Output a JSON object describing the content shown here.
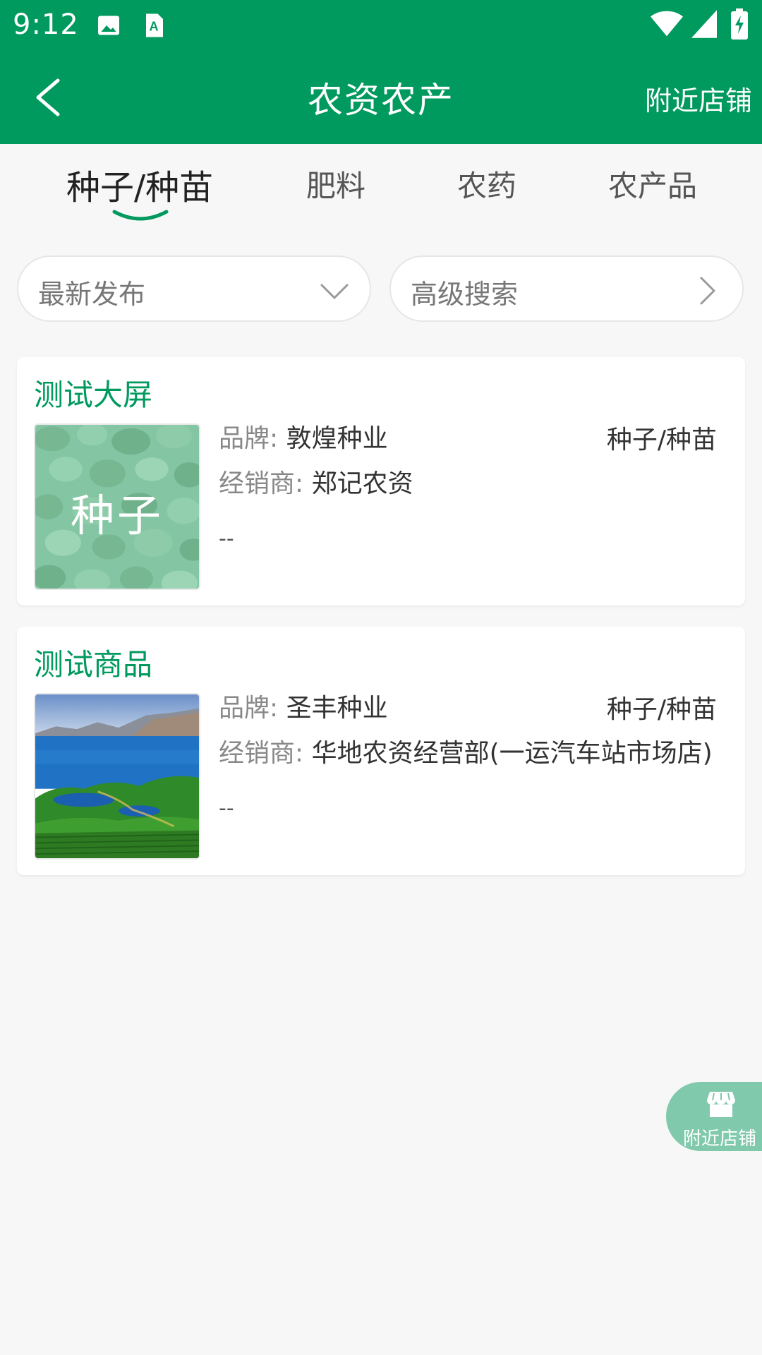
{
  "status_bar": {
    "time": "9:12",
    "icons": [
      "image-icon",
      "keyboard-a-icon",
      "wifi-icon",
      "signal-icon",
      "battery-charging-icon"
    ]
  },
  "app_bar": {
    "title": "农资农产",
    "action_label": "附近店铺",
    "background": "#00995e"
  },
  "tabs": [
    {
      "label": "种子/种苗",
      "active": true
    },
    {
      "label": "肥料",
      "active": false
    },
    {
      "label": "农药",
      "active": false
    },
    {
      "label": "农产品",
      "active": false
    }
  ],
  "filters": {
    "sort_label": "最新发布",
    "advanced_label": "高级搜索"
  },
  "products": [
    {
      "title": "测试大屏",
      "image_text": "种子",
      "brand_label": "品牌:",
      "brand": "敦煌种业",
      "category": "种子/种苗",
      "dealer_label": "经销商:",
      "dealer": "郑记农资",
      "extra": "--"
    },
    {
      "title": "测试商品",
      "brand_label": "品牌:",
      "brand": "圣丰种业",
      "category": "种子/种苗",
      "dealer_label": "经销商:",
      "dealer": "华地农资经营部(一运汽车站市场店)",
      "extra": "--"
    }
  ],
  "floating_button": {
    "label": "附近店铺",
    "icon": "store-icon"
  },
  "colors": {
    "primary": "#00995e",
    "title_green": "#00995e",
    "float_button": "#80c9ad"
  }
}
